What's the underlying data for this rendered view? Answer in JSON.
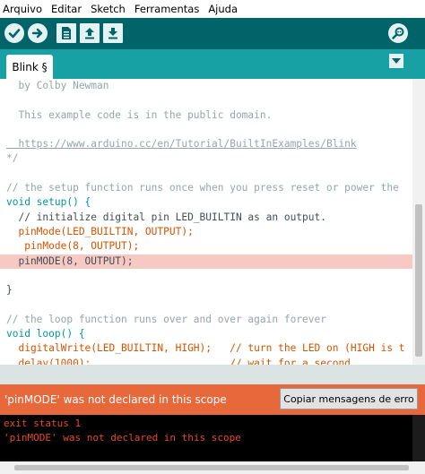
{
  "menu": [
    "Arquivo",
    "Editar",
    "Sketch",
    "Ferramentas",
    "Ajuda"
  ],
  "toolbar": {
    "icons": [
      "verify-icon",
      "upload-icon",
      "new-icon",
      "open-icon",
      "save-icon",
      "serial-monitor-icon"
    ]
  },
  "tabs": {
    "active": "Blink §"
  },
  "editor": {
    "lines": [
      "  by Colby Newman",
      "",
      "  This example code is in the public domain.",
      "",
      "  https://www.arduino.cc/en/Tutorial/BuiltInExamples/Blink",
      "*/",
      "",
      "// the setup function runs once when you press reset or power the",
      "void setup() {",
      "  // initialize digital pin LED_BUILTIN as an output.",
      "  pinMode(LED_BUILTIN, OUTPUT);",
      "   pinMode(8, OUTPUT);",
      "  pinMODE(8, OUTPUT);",
      "",
      "}",
      "",
      "// the loop function runs over and over again forever",
      "void loop() {",
      "  digitalWrite(LED_BUILTIN, HIGH);   // turn the LED on (HIGH is t",
      "  delay(1000);                       // wait for a second"
    ]
  },
  "status": {
    "message": "'pinMODE' was not declared in this scope",
    "copy_button": "Copiar mensagens de erro"
  },
  "console": {
    "lines": [
      "exit status 1",
      "'pinMODE' was not declared in this scope"
    ]
  },
  "colors": {
    "toolbar": "#006468",
    "tabbar": "#17a1a5",
    "error_bar": "#e7693b",
    "error_line_highlight": "#f7c9c5",
    "console_text": "#e34c22"
  }
}
